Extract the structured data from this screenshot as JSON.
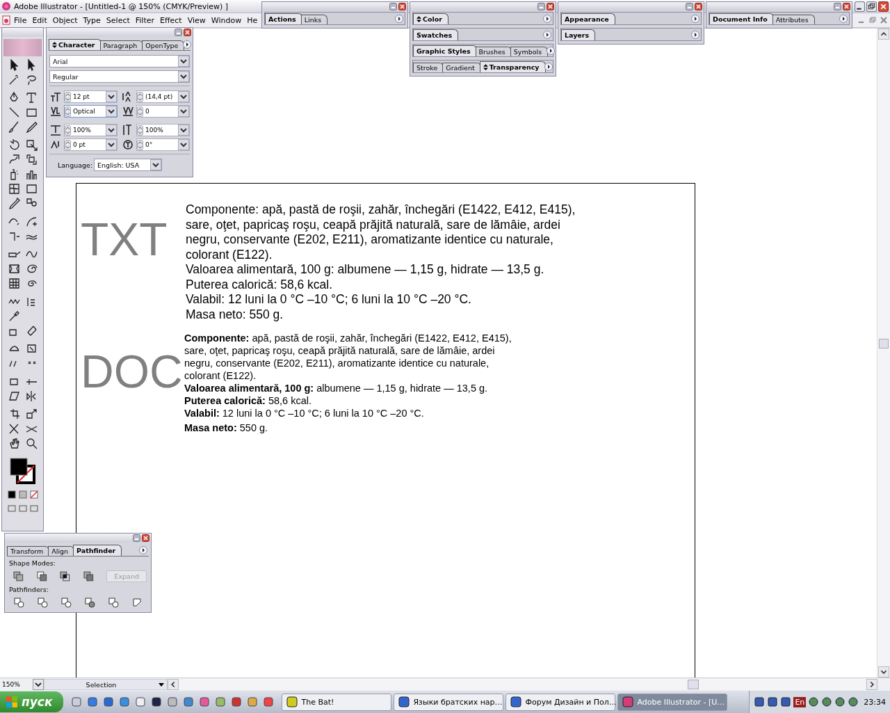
{
  "window": {
    "title": "Adobe Illustrator - [Untitled-1 @ 150% (CMYK/Preview) ]"
  },
  "menu": [
    "File",
    "Edit",
    "Object",
    "Type",
    "Select",
    "Filter",
    "Effect",
    "View",
    "Window",
    "He"
  ],
  "docked_panels": [
    {
      "rows": [
        {
          "tabs": [
            {
              "label": "Actions",
              "selected": true,
              "toggle": false
            },
            {
              "label": "Links",
              "selected": false,
              "toggle": false
            }
          ]
        }
      ]
    },
    {
      "rows": [
        {
          "tabs": [
            {
              "label": "Color",
              "selected": true,
              "toggle": true
            }
          ]
        },
        {
          "tabs": [
            {
              "label": "Swatches",
              "selected": true,
              "toggle": false
            }
          ]
        },
        {
          "tabs": [
            {
              "label": "Graphic Styles",
              "selected": true,
              "toggle": false
            },
            {
              "label": "Brushes",
              "selected": false,
              "toggle": false
            },
            {
              "label": "Symbols",
              "selected": false,
              "toggle": false
            }
          ]
        },
        {
          "tabs": [
            {
              "label": "Stroke",
              "selected": false,
              "toggle": false
            },
            {
              "label": "Gradient",
              "selected": false,
              "toggle": false
            },
            {
              "label": "Transparency",
              "selected": true,
              "toggle": true
            }
          ]
        }
      ]
    },
    {
      "rows": [
        {
          "tabs": [
            {
              "label": "Appearance",
              "selected": true,
              "toggle": false
            }
          ]
        },
        {
          "tabs": [
            {
              "label": "Layers",
              "selected": true,
              "toggle": false
            }
          ]
        }
      ]
    },
    {
      "rows": [
        {
          "tabs": [
            {
              "label": "Document Info",
              "selected": true,
              "toggle": false
            },
            {
              "label": "Attributes",
              "selected": false,
              "toggle": false
            }
          ]
        }
      ]
    }
  ],
  "character_panel": {
    "tabs": [
      {
        "label": "Character",
        "selected": true,
        "toggle": true
      },
      {
        "label": "Paragraph",
        "selected": false,
        "toggle": false
      },
      {
        "label": "OpenType",
        "selected": false,
        "toggle": false
      }
    ],
    "font": "Arial",
    "style": "Regular",
    "fields": [
      {
        "value": "12 pt"
      },
      {
        "value": "(14,4 pt)"
      },
      {
        "value": "Optical"
      },
      {
        "value": "0"
      },
      {
        "value": "100%"
      },
      {
        "value": "100%"
      },
      {
        "value": "0 pt"
      },
      {
        "value": "0°"
      }
    ],
    "language_label": "Language:",
    "language": "English: USA"
  },
  "pathfinder_panel": {
    "tabs": [
      {
        "label": "Transform",
        "selected": false,
        "toggle": false
      },
      {
        "label": "Align",
        "selected": false,
        "toggle": false
      },
      {
        "label": "Pathfinder",
        "selected": true,
        "toggle": false
      }
    ],
    "shape_modes_label": "Shape Modes:",
    "expand_button": {
      "label": "Expand",
      "disabled": true
    },
    "pathfinders_label": "Pathfinders:"
  },
  "artboard": {
    "blocks": [
      {
        "label": "TXT",
        "kind": "text",
        "paragraphs": [
          [
            "Componente: apă, pastă de roşii, zahăr, închegări (E1422, E412, E415),",
            "sare, oţet, papricaş roşu, ceapă prăjită naturală, sare de lămâie, ardei",
            "negru, conservante (E202, E211), aromatizante identice cu naturale,",
            "colorant (E122)."
          ],
          [
            "Valoarea alimentară, 100 g: albumene — 1,15 g, hidrate — 13,5 g."
          ],
          [
            "Puterea calorică: 58,6 kcal."
          ],
          [
            "Valabil: 12 luni la 0 °C –10 °C; 6 luni la 10 °C –20 °C."
          ],
          [
            "Masa neto: 550 g."
          ]
        ]
      },
      {
        "label": "DOC",
        "kind": "document",
        "paragraphs": [
          [
            "**Componente:** apă, pastă de roşii, zahăr, închegări (E1422, E412, E415),",
            "sare, oţet, papricaş roşu, ceapă prăjită naturală, sare de lămâie, ardei",
            "negru, conservante (E202, E211), aromatizante identice cu naturale,",
            "colorant (E122)."
          ],
          [
            "**Valoarea alimentară, 100 g:** albumene — 1,15 g, hidrate — 13,5 g."
          ],
          [
            "**Puterea calorică:** 58,6 kcal."
          ],
          [
            "**Valabil:** 12 luni la 0 °C –10 °C; 6 luni la 10 °C –20 °C."
          ],
          [
            "**Masa neto:** 550 g."
          ]
        ]
      }
    ]
  },
  "status_bar": {
    "zoom": "150%",
    "tool": "Selection"
  },
  "taskbar": {
    "start": "пуск",
    "tasks": [
      {
        "label": "The Bat!",
        "selected": false
      },
      {
        "label": "Языки братских нар…",
        "selected": false
      },
      {
        "label": "Форум Дизайн и Пол…",
        "selected": false
      },
      {
        "label": "Adobe Illustrator - [U…",
        "selected": true
      }
    ],
    "language": "En",
    "clock": "23:34"
  }
}
